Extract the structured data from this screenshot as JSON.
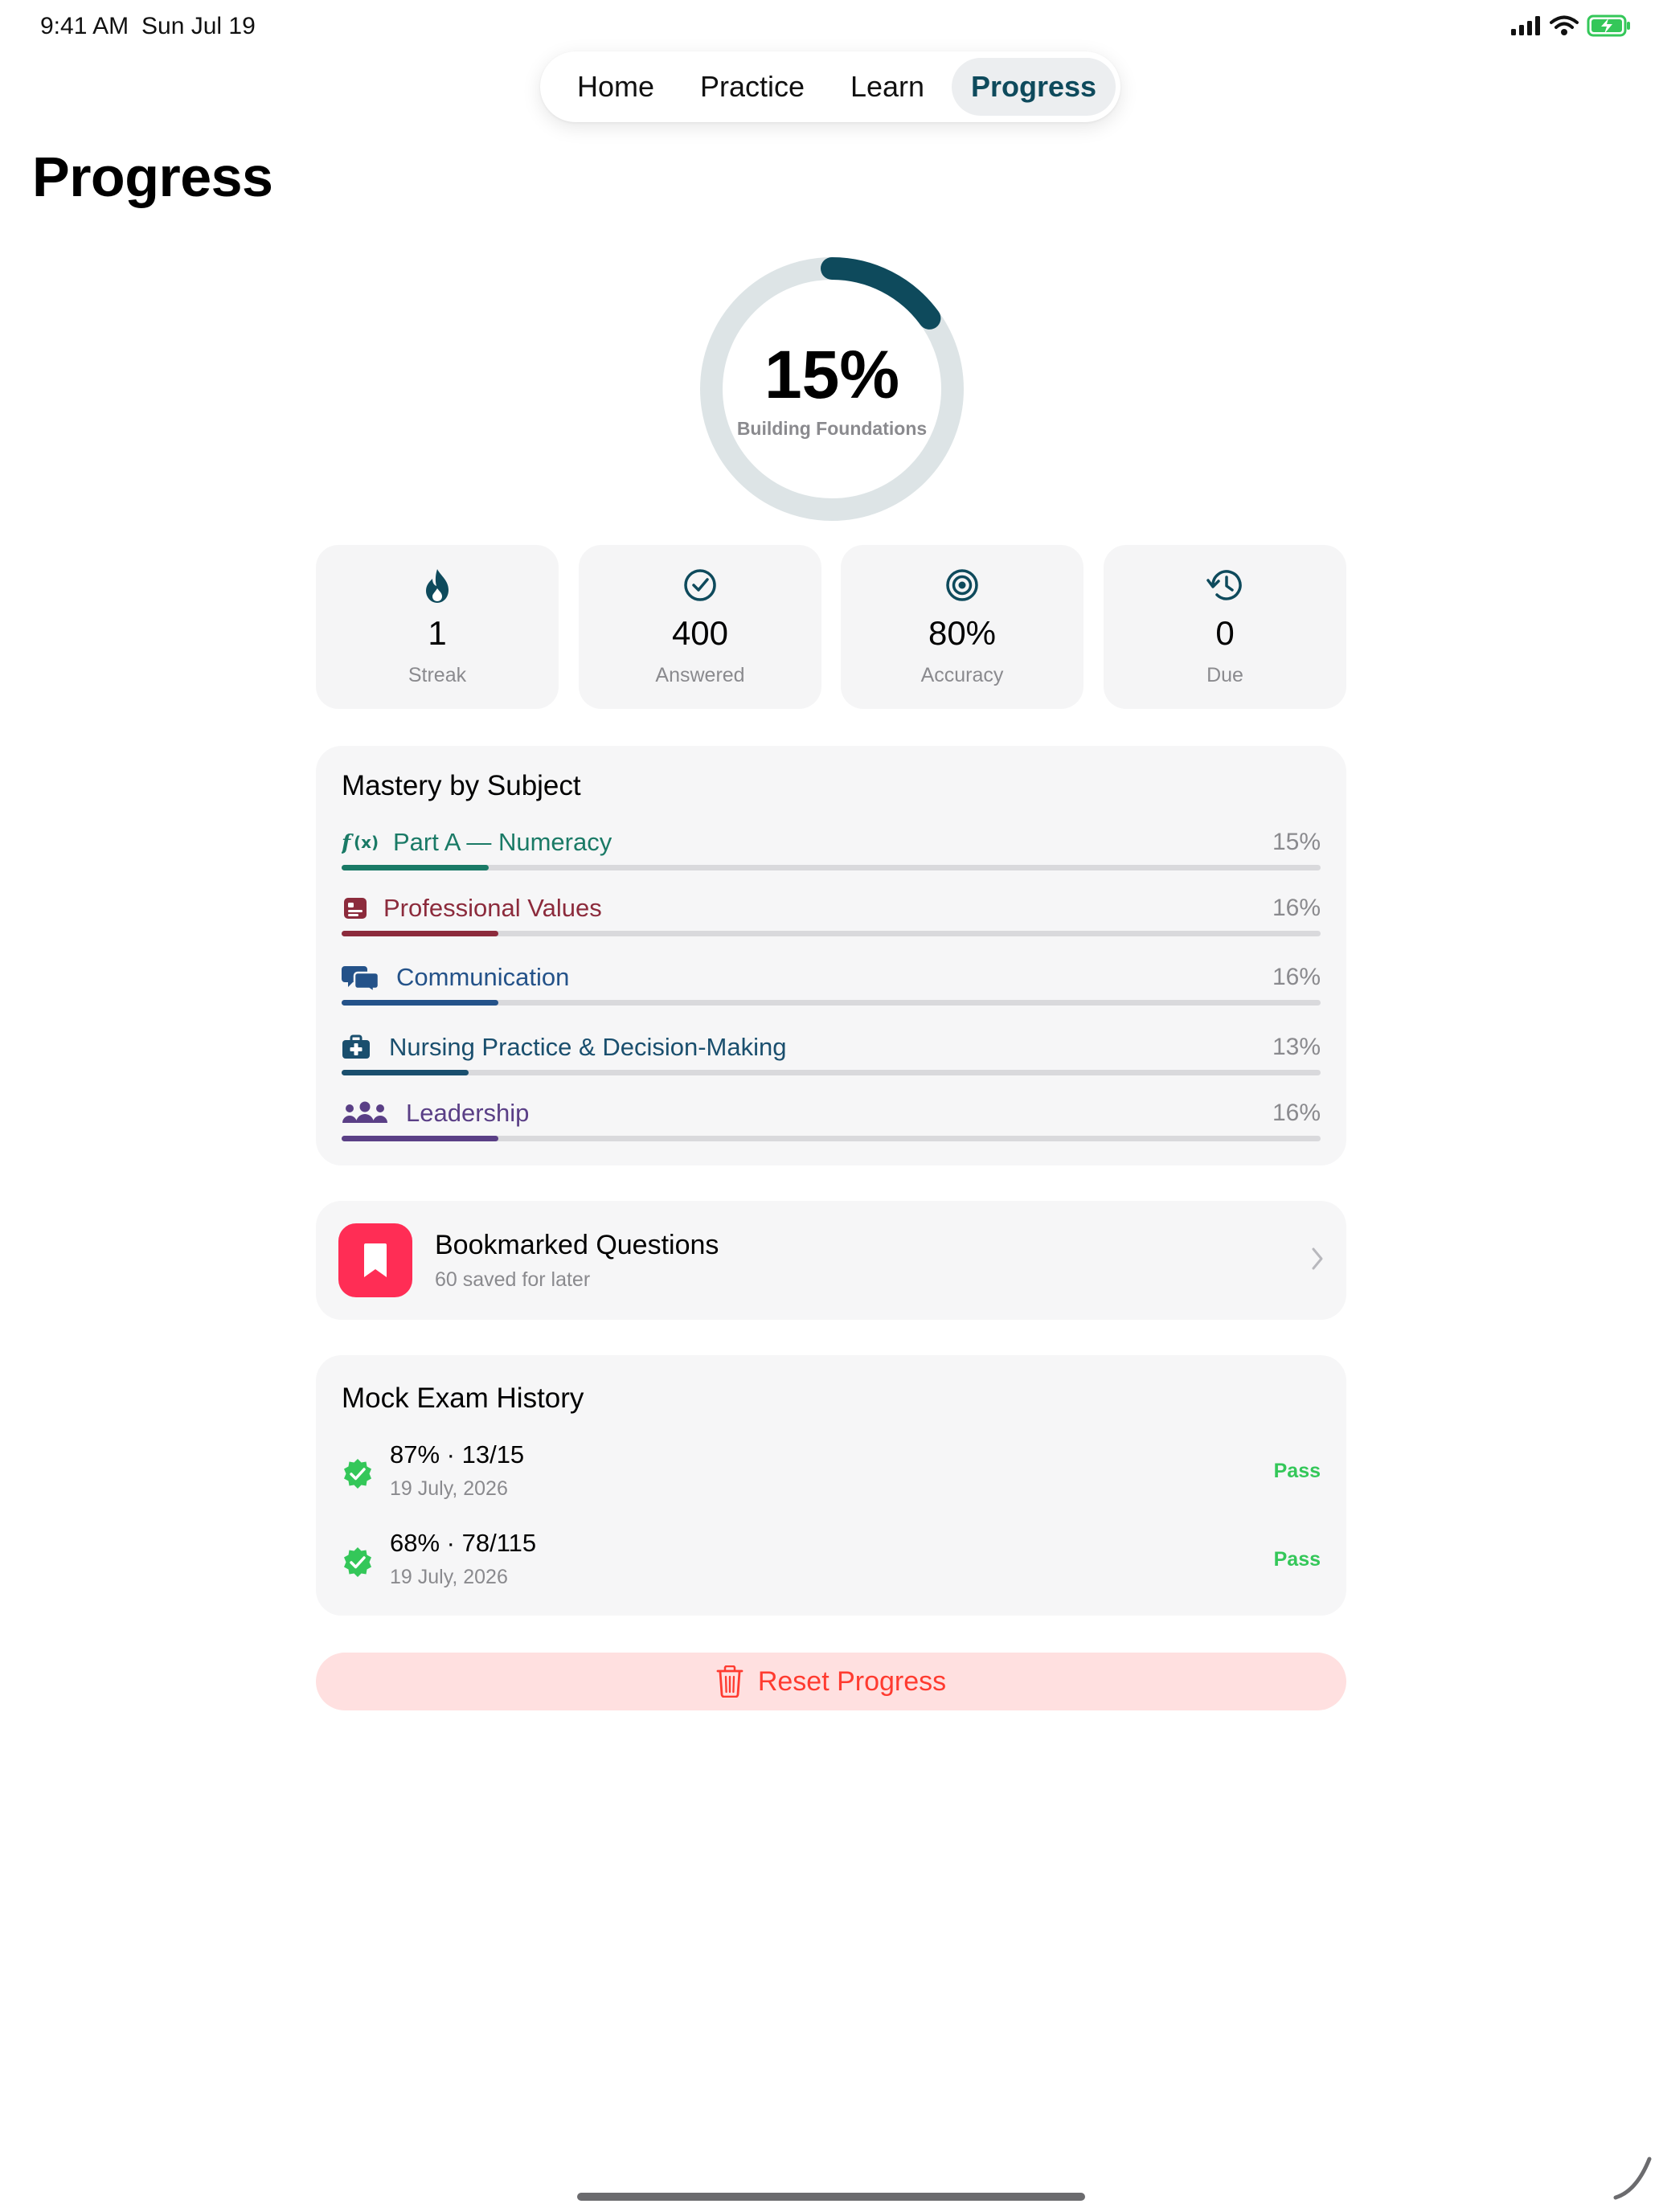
{
  "status_bar": {
    "time": "9:41 AM",
    "date": "Sun Jul 19"
  },
  "nav": {
    "tabs": [
      {
        "label": "Home",
        "active": false
      },
      {
        "label": "Practice",
        "active": false
      },
      {
        "label": "Learn",
        "active": false
      },
      {
        "label": "Progress",
        "active": true
      }
    ]
  },
  "page_title": "Progress",
  "overall": {
    "percent_label": "15%",
    "percent_value": 15,
    "level_label": "Building Foundations"
  },
  "stats": [
    {
      "icon": "flame-icon",
      "value": "1",
      "label": "Streak"
    },
    {
      "icon": "checkmark-circle-icon",
      "value": "400",
      "label": "Answered"
    },
    {
      "icon": "target-icon",
      "value": "80%",
      "label": "Accuracy"
    },
    {
      "icon": "clock-history-icon",
      "value": "0",
      "label": "Due"
    }
  ],
  "mastery": {
    "title": "Mastery by Subject",
    "subjects": [
      {
        "icon": "function-icon",
        "name": "Part A — Numeracy",
        "percent_label": "15%",
        "value": 15,
        "color": "#1a7a66"
      },
      {
        "icon": "id-card-icon",
        "name": "Professional Values",
        "percent_label": "16%",
        "value": 16,
        "color": "#8c2b3c"
      },
      {
        "icon": "chat-bubbles-icon",
        "name": "Communication",
        "percent_label": "16%",
        "value": 16,
        "color": "#245289"
      },
      {
        "icon": "medical-bag-icon",
        "name": "Nursing Practice & Decision-Making",
        "percent_label": "13%",
        "value": 13,
        "color": "#1a4f6e"
      },
      {
        "icon": "people-icon",
        "name": "Leadership",
        "percent_label": "16%",
        "value": 16,
        "color": "#5a3f86"
      }
    ]
  },
  "bookmarks": {
    "icon": "bookmark-icon",
    "title": "Bookmarked Questions",
    "subtitle": "60 saved for later",
    "badge_color": "#ff2d55"
  },
  "mock_history": {
    "title": "Mock Exam History",
    "exams": [
      {
        "score": "87% · 13/15",
        "date": "19 July, 2026",
        "status": "Pass"
      },
      {
        "score": "68% · 78/115",
        "date": "19 July, 2026",
        "status": "Pass"
      }
    ]
  },
  "reset": {
    "label": "Reset Progress",
    "color": "#ff3b30"
  },
  "colors": {
    "accent": "#0e4a5c",
    "pass": "#34c759",
    "ring_track": "#dde4e6"
  }
}
